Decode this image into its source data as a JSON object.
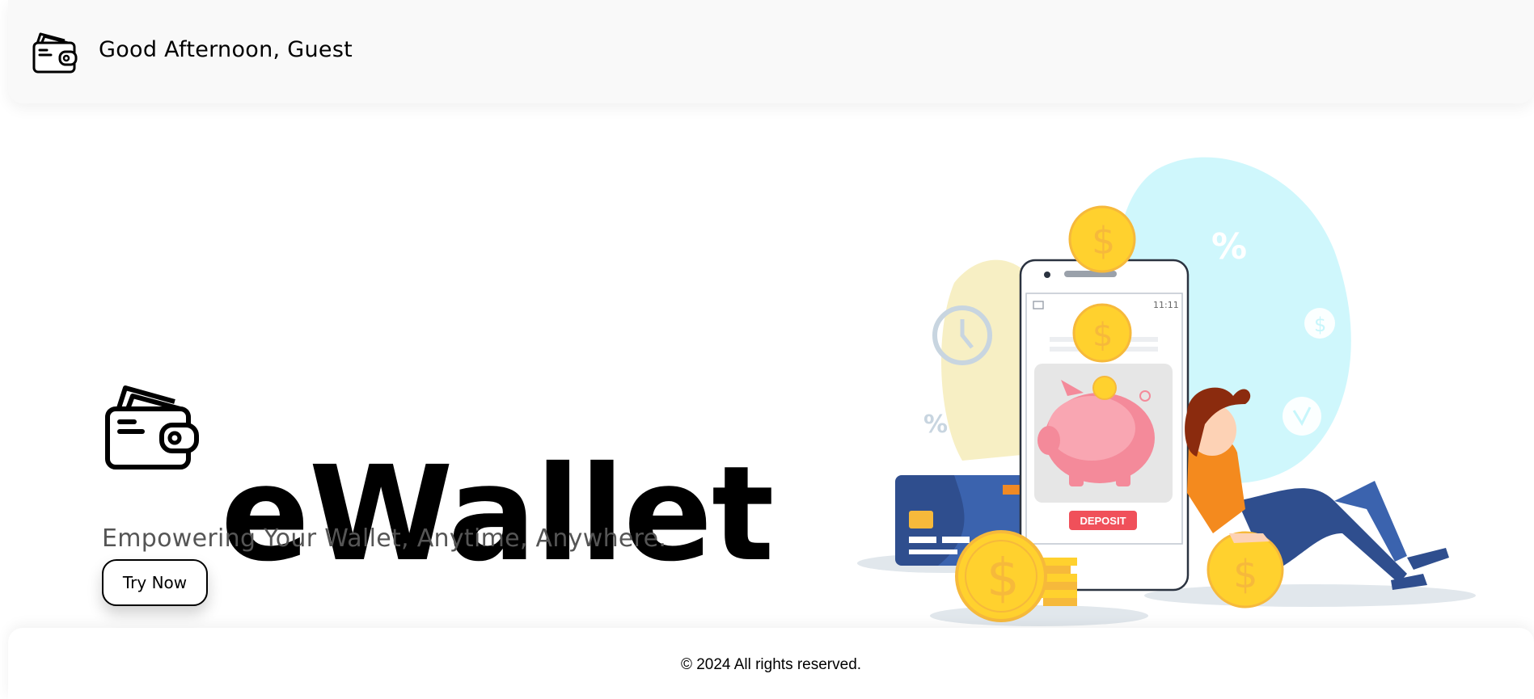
{
  "header": {
    "greeting": "Good Afternoon, Guest",
    "logo_icon": "wallet-icon"
  },
  "hero": {
    "logo_icon": "wallet-icon",
    "title": "eWallet",
    "subtitle": "Empowering Your Wallet, Anytime, Anywhere.",
    "cta_label": "Try Now"
  },
  "illustration": {
    "phone_time": "11:11",
    "deposit_label": "DEPOSIT",
    "percent_symbol": "%",
    "dollar_symbol": "$"
  },
  "footer": {
    "copyright": "© 2024 All rights reserved."
  },
  "colors": {
    "coin_gold": "#FFD12E",
    "deposit_red": "#F0505A",
    "blob_cyan": "#C7F6FB",
    "card_blue": "#2F4E8E"
  }
}
